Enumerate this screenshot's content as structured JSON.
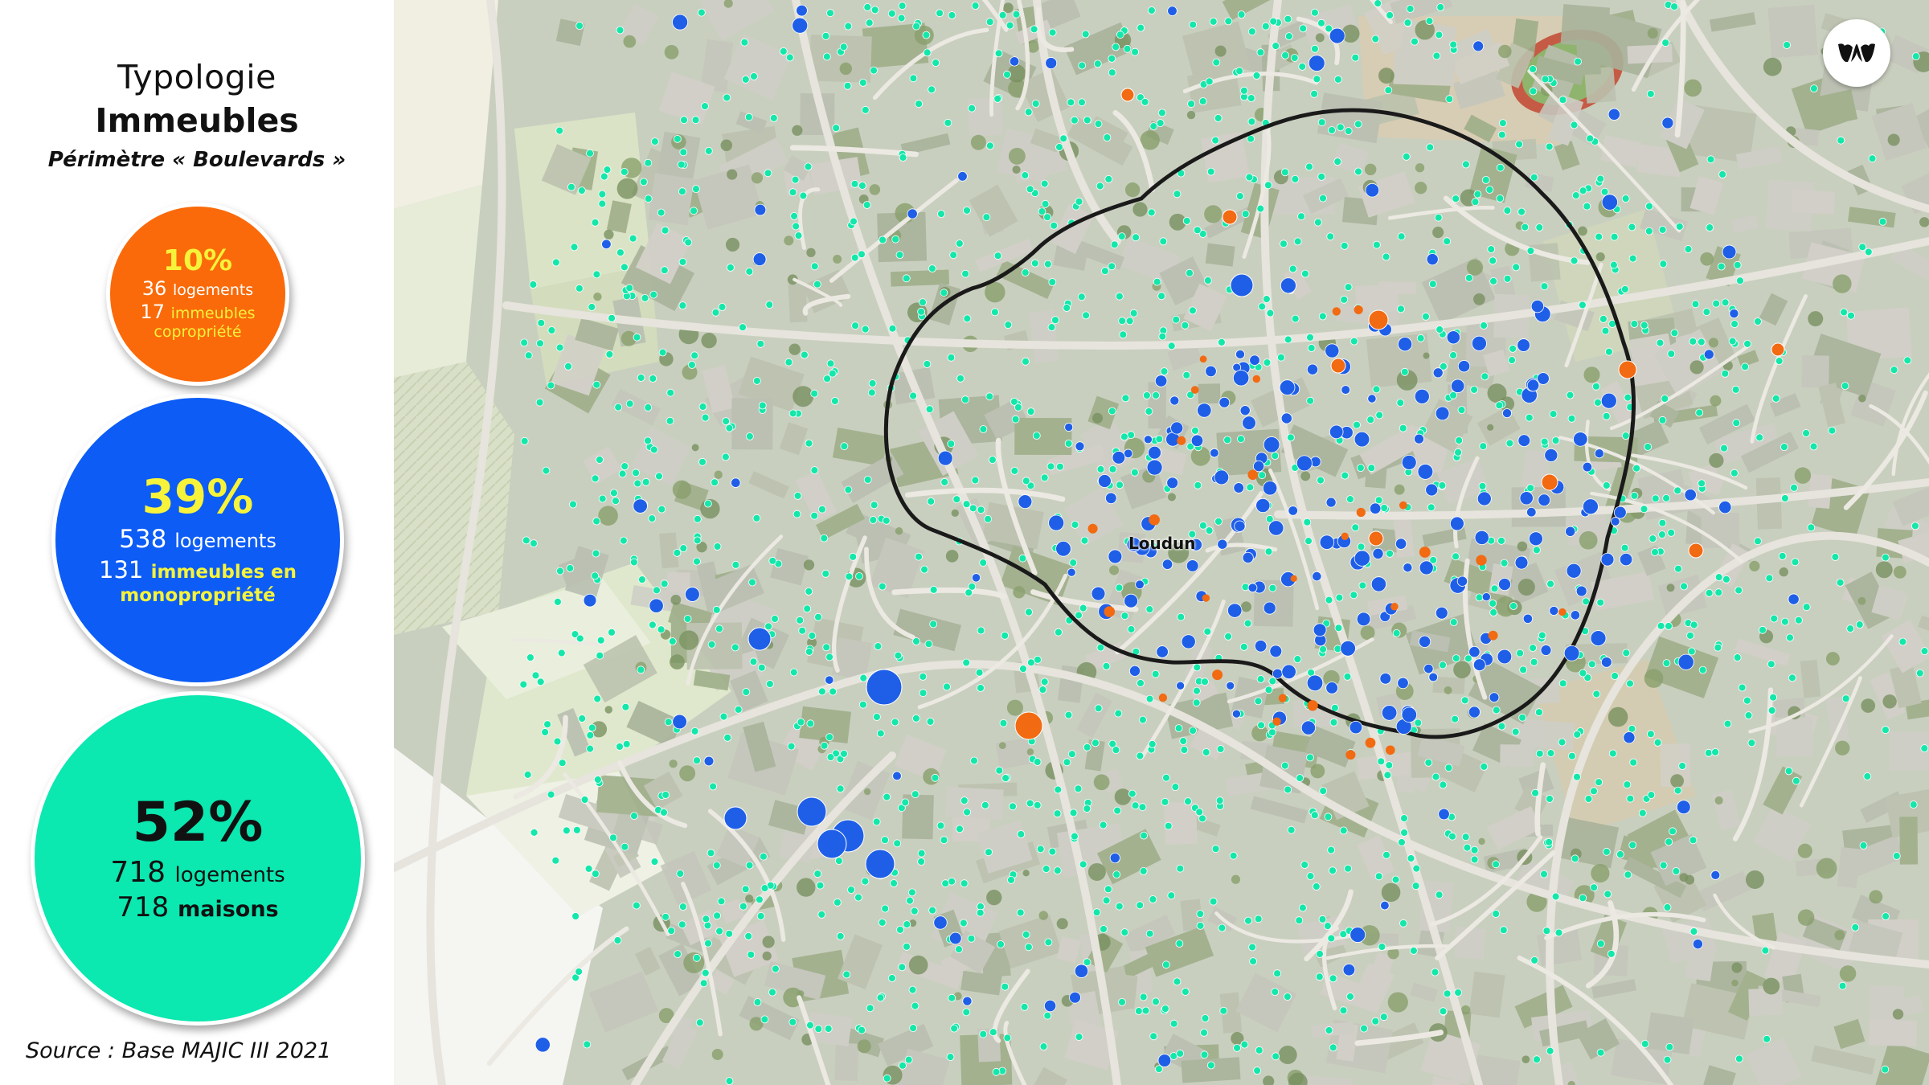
{
  "header": {
    "title_line1": "Typologie",
    "title_line2": "Immeubles",
    "subtitle": "Périmètre « Boulevards »"
  },
  "stats": {
    "copropriete": {
      "percent": "10%",
      "logements_count": "36",
      "logements_label": "logements",
      "immeubles_count": "17",
      "immeubles_label": "immeubles",
      "type_label": "copropriété",
      "color": "#fa6a0a"
    },
    "monopropriete": {
      "percent": "39%",
      "logements_count": "538",
      "logements_label": "logements",
      "immeubles_count": "131",
      "immeubles_label": "immeubles en",
      "type_label": "monopropriété",
      "color": "#0c5cf5"
    },
    "maisons": {
      "percent": "52%",
      "logements_count": "718",
      "logements_label": "logements",
      "maisons_count": "718",
      "maisons_label": "maisons",
      "color": "#0be8b0"
    }
  },
  "source": "Source : Base MAJIC III 2021",
  "map": {
    "town_label": "Loudun",
    "perimeter_color": "#1a1a1a",
    "logo_icon": "brand-logo-icon"
  }
}
